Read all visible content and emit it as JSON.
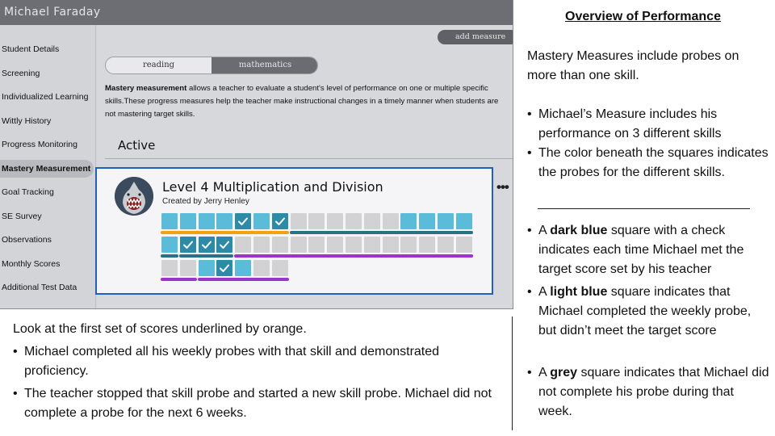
{
  "app": {
    "title": "Michael Faraday",
    "sidebar": {
      "items": [
        {
          "label": "Student Details"
        },
        {
          "label": "Screening"
        },
        {
          "label": "Individualized Learning"
        },
        {
          "label": "Wittly History"
        },
        {
          "label": "Progress Monitoring"
        },
        {
          "label": "Mastery Measurement",
          "active": true
        },
        {
          "label": "Goal Tracking"
        },
        {
          "label": "SE Survey"
        },
        {
          "label": "Observations"
        },
        {
          "label": "Monthly Scores"
        },
        {
          "label": "Additional Test Data"
        }
      ]
    },
    "add_measure_label": "add measure",
    "subject_tabs": [
      {
        "label": "reading",
        "selected": false
      },
      {
        "label": "mathematics",
        "selected": true
      }
    ],
    "description_bold": "Mastery measurement",
    "description_rest": " allows a teacher to evaluate a student's level of performance on one or multiple specific skills.These progress measures help the teacher make instructional changes in a timely manner when students are not mastering target skills.",
    "section_label": "Active",
    "card": {
      "title": "Level 4 Multiplication and Division",
      "creator": "Created by Jerry Henley",
      "more_label": "•••",
      "avatar_icon": "shark-icon",
      "rows": [
        [
          "light",
          "light",
          "light",
          "light",
          "dark",
          "light",
          "dark",
          "grey",
          "grey",
          "grey",
          "grey",
          "grey",
          "grey",
          "light",
          "light",
          "light",
          "light"
        ],
        [
          "light",
          "dark",
          "dark",
          "dark",
          "grey",
          "grey",
          "grey",
          "grey",
          "grey",
          "grey",
          "grey",
          "grey",
          "grey",
          "grey",
          "grey",
          "grey",
          "grey"
        ],
        [
          "grey",
          "grey",
          "light",
          "dark",
          "light",
          "grey",
          "grey"
        ]
      ],
      "skill_lines": [
        [
          {
            "skill": 1,
            "color": "#f2a20f",
            "from": 0,
            "to": 6
          },
          {
            "skill": 2,
            "color": "#2a7185",
            "from": 7,
            "to": 16
          }
        ],
        [
          {
            "skill": 2,
            "color": "#2a7185",
            "from": 0,
            "to": 0
          },
          {
            "skill": 3,
            "color": "#2a7185",
            "from": 1,
            "to": 3
          },
          {
            "skill": 4,
            "color": "#9a35c9",
            "from": 4,
            "to": 16
          }
        ],
        [
          {
            "skill": 4,
            "color": "#9a35c9",
            "from": 0,
            "to": 1
          },
          {
            "skill": 5,
            "color": "#9a35c9",
            "from": 2,
            "to": 6
          }
        ]
      ],
      "status_colors": {
        "dark": "#2c8ba6",
        "light": "#5bbcd9",
        "grey": "#d2d2d5"
      }
    }
  },
  "bottom_note": {
    "intro": "Look at the first set of scores underlined by orange.",
    "bullets": [
      "Michael completed all his weekly probes with that skill and demonstrated proficiency.",
      "The teacher stopped that skill probe and started a new skill probe. Michael did not complete a probe for the next 6 weeks."
    ]
  },
  "overview": {
    "title": "Overview of Performance",
    "intro": "Mastery Measures include probes on more than one skill.",
    "bullets": [
      "Michael’s Measure includes his performance on 3 different skills",
      "The color beneath the squares indicates the probes for the different skills."
    ],
    "legend": [
      {
        "pre": "A ",
        "bold": "dark blue",
        "post": " square with a check indicates each time Michael met the target score set by his teacher"
      },
      {
        "pre": "A ",
        "bold": "light blue",
        "post": " square indicates that Michael completed the weekly probe, but didn’t meet the target score"
      },
      {
        "pre": "A ",
        "bold": "grey",
        "post": " square indicates that Michael did not complete his probe during that week."
      }
    ],
    "bullet_char": "•"
  }
}
